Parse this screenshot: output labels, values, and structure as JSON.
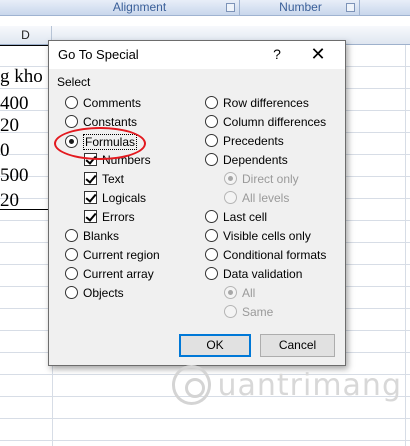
{
  "ribbon": {
    "groups": [
      {
        "label": "Alignment"
      },
      {
        "label": "Number"
      }
    ]
  },
  "sheet": {
    "column_headers": [
      "D"
    ],
    "cells": [
      "g kho",
      "400",
      "20",
      "0",
      "500",
      "20"
    ]
  },
  "dialog": {
    "title": "Go To Special",
    "help_glyph": "?",
    "close_glyph": "✕",
    "section_label": "Select",
    "left_options": [
      {
        "label": "Comments",
        "type": "radio",
        "checked": false
      },
      {
        "label": "Constants",
        "type": "radio",
        "checked": false
      },
      {
        "label": "Formulas",
        "type": "radio",
        "checked": true
      },
      {
        "label": "Numbers",
        "type": "checkbox",
        "checked": true
      },
      {
        "label": "Text",
        "type": "checkbox",
        "checked": true
      },
      {
        "label": "Logicals",
        "type": "checkbox",
        "checked": true
      },
      {
        "label": "Errors",
        "type": "checkbox",
        "checked": true
      },
      {
        "label": "Blanks",
        "type": "radio",
        "checked": false
      },
      {
        "label": "Current region",
        "type": "radio",
        "checked": false
      },
      {
        "label": "Current array",
        "type": "radio",
        "checked": false
      },
      {
        "label": "Objects",
        "type": "radio",
        "checked": false
      }
    ],
    "right_options": [
      {
        "label": "Row differences",
        "type": "radio",
        "checked": false,
        "disabled": false
      },
      {
        "label": "Column differences",
        "type": "radio",
        "checked": false,
        "disabled": false
      },
      {
        "label": "Precedents",
        "type": "radio",
        "checked": false,
        "disabled": false
      },
      {
        "label": "Dependents",
        "type": "radio",
        "checked": false,
        "disabled": false
      },
      {
        "label": "Direct only",
        "type": "radio",
        "checked": true,
        "disabled": true
      },
      {
        "label": "All levels",
        "type": "radio",
        "checked": false,
        "disabled": true
      },
      {
        "label": "Last cell",
        "type": "radio",
        "checked": false,
        "disabled": false
      },
      {
        "label": "Visible cells only",
        "type": "radio",
        "checked": false,
        "disabled": false
      },
      {
        "label": "Conditional formats",
        "type": "radio",
        "checked": false,
        "disabled": false
      },
      {
        "label": "Data validation",
        "type": "radio",
        "checked": false,
        "disabled": false
      },
      {
        "label": "All",
        "type": "radio",
        "checked": true,
        "disabled": true
      },
      {
        "label": "Same",
        "type": "radio",
        "checked": false,
        "disabled": true
      }
    ],
    "ok_label": "OK",
    "cancel_label": "Cancel",
    "highlight_color": "#e3191f",
    "ok_focus_color": "#0078d7"
  },
  "watermark": {
    "text": "uantrimang"
  }
}
